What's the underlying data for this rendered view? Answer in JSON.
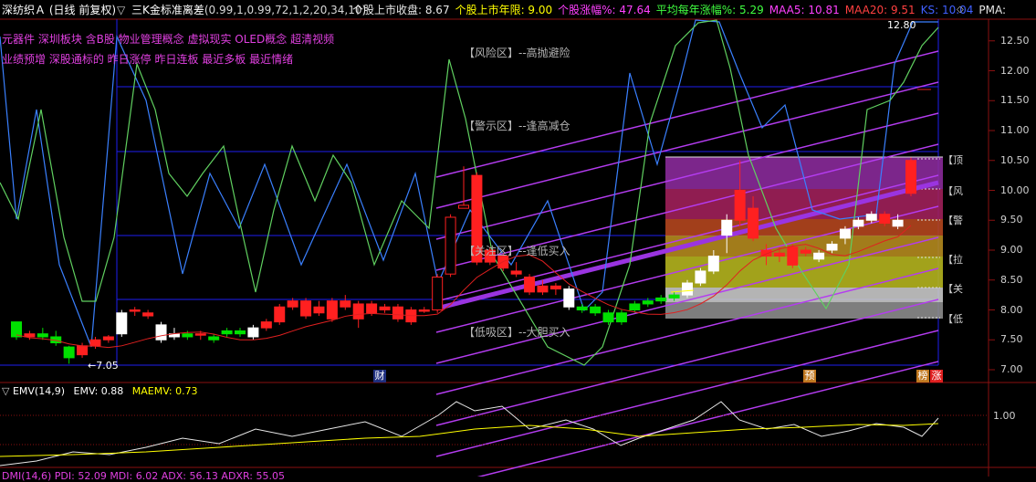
{
  "header": {
    "stock_name": "深纺织Ａ",
    "period": "(日线 前复权)",
    "indicator": "三K金标准离差",
    "params": "(0.99,1,0.99,72,1,2,20,34,10)",
    "fields": [
      {
        "label": "个股上市收盘: 8.67",
        "color": "#e8e8e8"
      },
      {
        "label": "个股上市年限: 9.00",
        "color": "#ffff00"
      },
      {
        "label": "个股涨幅%: 47.64",
        "color": "#ff40ff"
      },
      {
        "label": "平均每年涨幅%: 5.29",
        "color": "#40ff40"
      },
      {
        "label": "MAA5: 10.81",
        "color": "#ff40ff"
      },
      {
        "label": "MAA20: 9.51",
        "color": "#ff4040"
      },
      {
        "label": "KS: 10.04",
        "color": "#4060ff"
      },
      {
        "label": "PMA:",
        "color": "#e8e8e8"
      }
    ]
  },
  "concept_tags": {
    "line1": "元器件 深圳板块 含B股 物业管理概念 虚拟现实 OLED概念 超清视频",
    "line2": "业绩预增 深股通标的 昨日涨停 昨日连板 最近多板 最近情绪"
  },
  "zone_labels": {
    "risk": "【风险区】--高抛避险",
    "warn": "【警示区】--逢高减仓",
    "watch": "【关注区】--逢低买入",
    "buy": "【低吸区】--大胆买入"
  },
  "right_labels": [
    "【顶",
    "【风",
    "【警",
    "【拉",
    "【关",
    "【低"
  ],
  "y_axis": [
    "12.50",
    "12.00",
    "11.50",
    "11.00",
    "10.50",
    "10.00",
    "9.50",
    "9.00",
    "8.50",
    "8.00",
    "7.50",
    "7.00"
  ],
  "annotations": {
    "high": "12.80",
    "low": "7.05",
    "cai": "财",
    "yu": "预",
    "bang": "榜",
    "zhang": "涨"
  },
  "emv_panel": {
    "title": "EMV(14,9)",
    "emv": "EMV: 0.88",
    "maemv": "MAEMV: 0.73",
    "level": "1.00"
  },
  "dmi_panel": {
    "text": "DMI(14,6)  PDI: 52.09  MDI: 6.02  ADX: 56.13  ADXR: 55.05"
  },
  "colors": {
    "up": "#ff2020",
    "down": "#00e000",
    "flat": "#ffffff",
    "grid": "#1e1ef0",
    "channel": "#b43cf0",
    "trend": "#9a34e0",
    "green_line": "#60d060",
    "blue_line": "#3a80ff",
    "ma_red": "#e02020"
  },
  "candles": [
    [
      7.8,
      7.55,
      7.8,
      7.5,
      "d"
    ],
    [
      7.55,
      7.6,
      7.65,
      7.5,
      "u"
    ],
    [
      7.6,
      7.55,
      7.7,
      7.5,
      "d"
    ],
    [
      7.55,
      7.45,
      7.65,
      7.4,
      "d"
    ],
    [
      7.38,
      7.2,
      7.4,
      7.1,
      "d"
    ],
    [
      7.25,
      7.4,
      7.45,
      7.2,
      "u"
    ],
    [
      7.4,
      7.5,
      7.55,
      7.35,
      "u"
    ],
    [
      7.5,
      7.55,
      7.58,
      7.45,
      "u"
    ],
    [
      7.6,
      7.95,
      8.0,
      7.55,
      "w"
    ],
    [
      7.98,
      8.0,
      8.05,
      7.9,
      "u"
    ],
    [
      7.95,
      7.9,
      8.0,
      7.85,
      "u"
    ],
    [
      7.75,
      7.5,
      7.8,
      7.45,
      "w"
    ],
    [
      7.55,
      7.6,
      7.7,
      7.5,
      "w"
    ],
    [
      7.6,
      7.55,
      7.65,
      7.5,
      "d"
    ],
    [
      7.58,
      7.6,
      7.65,
      7.5,
      "u"
    ],
    [
      7.55,
      7.5,
      7.6,
      7.45,
      "d"
    ],
    [
      7.6,
      7.65,
      7.7,
      7.55,
      "d"
    ],
    [
      7.65,
      7.6,
      7.7,
      7.55,
      "d"
    ],
    [
      7.55,
      7.7,
      7.75,
      7.5,
      "w"
    ],
    [
      7.7,
      7.8,
      7.85,
      7.65,
      "u"
    ],
    [
      7.8,
      8.05,
      8.1,
      7.75,
      "u"
    ],
    [
      8.05,
      8.15,
      8.2,
      8.0,
      "u"
    ],
    [
      8.15,
      7.9,
      8.2,
      7.85,
      "u"
    ],
    [
      7.95,
      8.05,
      8.15,
      7.9,
      "u"
    ],
    [
      7.85,
      8.15,
      8.2,
      7.8,
      "u"
    ],
    [
      8.15,
      8.05,
      8.25,
      8.0,
      "u"
    ],
    [
      8.1,
      7.85,
      8.15,
      7.7,
      "u"
    ],
    [
      8.1,
      7.95,
      8.15,
      7.9,
      "u"
    ],
    [
      8.0,
      8.05,
      8.1,
      7.95,
      "u"
    ],
    [
      8.05,
      7.85,
      8.1,
      7.8,
      "u"
    ],
    [
      8.0,
      7.8,
      8.05,
      7.75,
      "u"
    ],
    [
      8.0,
      8.0,
      8.05,
      7.95,
      "u"
    ],
    [
      8.0,
      8.55,
      8.6,
      7.95,
      "u"
    ],
    [
      8.6,
      9.55,
      9.6,
      8.55,
      "u"
    ],
    [
      9.7,
      9.75,
      10.4,
      9.7,
      "u"
    ],
    [
      10.25,
      8.8,
      10.3,
      8.75,
      "u"
    ],
    [
      8.8,
      9.0,
      9.05,
      8.75,
      "u"
    ],
    [
      8.7,
      8.9,
      8.95,
      8.65,
      "u"
    ],
    [
      8.65,
      8.6,
      8.8,
      8.55,
      "u"
    ],
    [
      8.55,
      8.3,
      8.6,
      8.25,
      "u"
    ],
    [
      8.3,
      8.4,
      8.5,
      8.25,
      "u"
    ],
    [
      8.4,
      8.35,
      8.45,
      8.25,
      "u"
    ],
    [
      8.35,
      8.05,
      8.4,
      8.0,
      "w"
    ],
    [
      8.05,
      8.0,
      8.1,
      7.95,
      "d"
    ],
    [
      8.05,
      7.95,
      8.1,
      7.9,
      "d"
    ],
    [
      7.95,
      7.8,
      8.0,
      7.75,
      "d"
    ],
    [
      7.8,
      7.95,
      8.0,
      7.75,
      "d"
    ],
    [
      8.0,
      8.1,
      8.15,
      7.95,
      "d"
    ],
    [
      8.1,
      8.15,
      8.2,
      8.05,
      "d"
    ],
    [
      8.15,
      8.2,
      8.25,
      8.1,
      "d"
    ],
    [
      8.2,
      8.25,
      8.3,
      8.15,
      "d"
    ],
    [
      8.25,
      8.45,
      8.5,
      8.2,
      "w"
    ],
    [
      8.45,
      8.65,
      8.7,
      8.4,
      "w"
    ],
    [
      8.65,
      8.9,
      9.0,
      8.6,
      "w"
    ],
    [
      9.5,
      9.25,
      9.6,
      8.95,
      "w"
    ],
    [
      9.5,
      10.0,
      10.5,
      9.4,
      "u"
    ],
    [
      9.2,
      9.7,
      9.9,
      9.15,
      "u"
    ],
    [
      8.9,
      9.0,
      9.1,
      8.75,
      "u"
    ],
    [
      8.95,
      8.9,
      9.05,
      8.8,
      "u"
    ],
    [
      8.75,
      9.05,
      9.1,
      8.7,
      "u"
    ],
    [
      9.0,
      8.95,
      9.05,
      8.9,
      "u"
    ],
    [
      8.85,
      8.95,
      9.0,
      8.8,
      "w"
    ],
    [
      9.0,
      9.1,
      9.15,
      8.95,
      "w"
    ],
    [
      9.2,
      9.35,
      9.4,
      9.1,
      "w"
    ],
    [
      9.4,
      9.5,
      9.55,
      9.35,
      "w"
    ],
    [
      9.6,
      9.5,
      9.65,
      9.45,
      "w"
    ],
    [
      9.45,
      9.6,
      9.65,
      9.4,
      "u"
    ],
    [
      9.4,
      9.5,
      9.6,
      9.35,
      "w"
    ],
    [
      9.95,
      10.5,
      10.55,
      9.9,
      "u"
    ]
  ]
}
